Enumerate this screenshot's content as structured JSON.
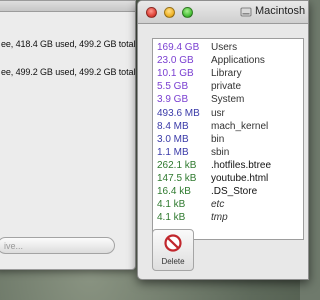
{
  "left_window": {
    "disk_line_1": "ee, 418.4 GB used, 499.2 GB total",
    "disk_line_2": "ee, 499.2 GB used, 499.2 GB total",
    "button_label": "ive..."
  },
  "right_window": {
    "title": "Macintosh",
    "items": [
      {
        "size": "169.4 GB",
        "name": "Users",
        "size_color": "#7a3fd1",
        "name_color": "#333333"
      },
      {
        "size": "23.0 GB",
        "name": "Applications",
        "size_color": "#7a3fd1",
        "name_color": "#333333"
      },
      {
        "size": "10.1 GB",
        "name": "Library",
        "size_color": "#7a3fd1",
        "name_color": "#333333"
      },
      {
        "size": "5.5 GB",
        "name": "private",
        "size_color": "#7a3fd1",
        "name_color": "#333333"
      },
      {
        "size": "3.9 GB",
        "name": "System",
        "size_color": "#7a3fd1",
        "name_color": "#333333"
      },
      {
        "size": "493.6 MB",
        "name": "usr",
        "size_color": "#3a3aa8",
        "name_color": "#333333"
      },
      {
        "size": "8.4 MB",
        "name": "mach_kernel",
        "size_color": "#3a3aa8",
        "name_color": "#333333"
      },
      {
        "size": "3.0 MB",
        "name": "bin",
        "size_color": "#3a3aa8",
        "name_color": "#333333"
      },
      {
        "size": "1.1 MB",
        "name": "sbin",
        "size_color": "#3a3aa8",
        "name_color": "#333333"
      },
      {
        "size": "262.1 kB",
        "name": ".hotfiles.btree",
        "size_color": "#2f7a2f",
        "name_color": "#111111"
      },
      {
        "size": "147.5 kB",
        "name": "youtube.html",
        "size_color": "#2f7a2f",
        "name_color": "#111111"
      },
      {
        "size": "16.4 kB",
        "name": ".DS_Store",
        "size_color": "#2f7a2f",
        "name_color": "#111111"
      },
      {
        "size": "4.1 kB",
        "name": "etc",
        "size_color": "#2f7a2f",
        "name_color": "#333333"
      },
      {
        "size": "4.1 kB",
        "name": "tmp",
        "size_color": "#2f7a2f",
        "name_color": "#333333"
      }
    ],
    "delete_label": "Delete"
  },
  "icons": {
    "title_icon": "disk-icon",
    "delete_icon": "no-symbol-icon"
  }
}
